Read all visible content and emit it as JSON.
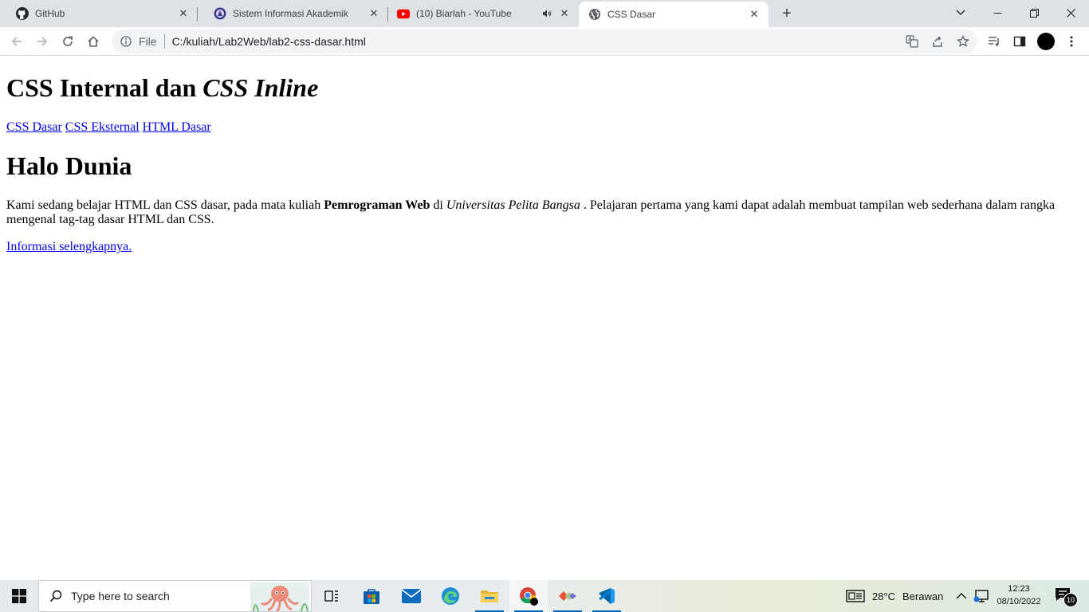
{
  "browser": {
    "tabs": [
      {
        "title": "GitHub",
        "icon": "github-icon"
      },
      {
        "title": "Sistem Informasi Akademik",
        "icon": "university-logo-icon"
      },
      {
        "title": "(10) Biarlah - YouTube",
        "icon": "youtube-icon",
        "audio": "speaker-icon"
      },
      {
        "title": "CSS Dasar",
        "icon": "globe-icon",
        "active": true
      }
    ],
    "address": {
      "scheme_label": "File",
      "url": "C:/kuliah/Lab2Web/lab2-css-dasar.html"
    }
  },
  "page": {
    "heading1_plain": "CSS Internal dan ",
    "heading1_italic": "CSS Inline",
    "nav_links": [
      "CSS Dasar",
      "CSS Eksternal",
      "HTML Dasar"
    ],
    "heading2": "Halo Dunia",
    "paragraph": {
      "part1": "Kami sedang belajar HTML dan CSS dasar, pada mata kuliah ",
      "bold": "Pemrograman Web",
      "part2": " di ",
      "italic": "Universitas Pelita Bangsa",
      "part3": " . Pelajaran pertama yang kami dapat adalah membuat tampilan web sederhana dalam rangka mengenal tag-tag dasar HTML dan CSS."
    },
    "more_link": "Informasi selengkapnya."
  },
  "taskbar": {
    "search_placeholder": "Type here to search",
    "apps": [
      "task-view-icon",
      "microsoft-store-icon",
      "mail-icon",
      "edge-icon",
      "file-explorer-icon",
      "chrome-icon",
      "git-icon",
      "vscode-icon"
    ],
    "weather_temp": "28°C",
    "weather_desc": "Berawan",
    "time": "12:23",
    "date": "08/10/2022",
    "notification_count": "10"
  },
  "colors": {
    "link": "#0000ee",
    "tabstrip": "#dee1e6",
    "omnibox": "#f1f3f4",
    "youtube_red": "#ff0000",
    "taskbar_accent": "#0067c0"
  }
}
